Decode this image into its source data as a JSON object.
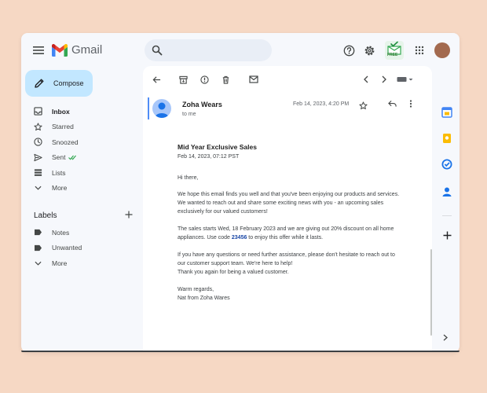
{
  "app": {
    "name": "Gmail",
    "colors": {
      "accent": "#c2e7ff",
      "brand_red": "#ea4335",
      "brand_blue": "#4285f4",
      "brand_green": "#34a853",
      "brand_yellow": "#fbbc04",
      "code": "#1a47a6"
    }
  },
  "topbar": {
    "icons": [
      "menu-icon",
      "gmail-logo",
      "search-icon",
      "help-icon",
      "settings-icon",
      "addon-icon",
      "apps-grid-icon",
      "account-avatar"
    ],
    "addon_badge": "FREE"
  },
  "compose": {
    "label": "Compose",
    "icon": "pencil-icon"
  },
  "nav": {
    "items": [
      {
        "label": "Inbox",
        "icon": "inbox-icon",
        "active": true
      },
      {
        "label": "Starred",
        "icon": "star-icon"
      },
      {
        "label": "Snoozed",
        "icon": "clock-icon"
      },
      {
        "label": "Sent",
        "icon": "send-icon"
      },
      {
        "label": "Lists",
        "icon": "list-icon"
      },
      {
        "label": "More",
        "icon": "chevron-down-icon"
      }
    ]
  },
  "labels": {
    "title": "Labels",
    "items": [
      {
        "label": "Notes",
        "icon": "label-icon"
      },
      {
        "label": "Unwanted",
        "icon": "label-icon"
      },
      {
        "label": "More",
        "icon": "chevron-down-icon"
      }
    ]
  },
  "toolbar": {
    "icons": [
      "back-arrow-icon",
      "archive-icon",
      "report-spam-icon",
      "delete-icon",
      "mark-unread-icon",
      "newer-icon",
      "older-icon",
      "keyboard-icon"
    ]
  },
  "email": {
    "sender": "Zoha Wears",
    "to": "to me",
    "date": "Feb 14, 2023, 4:20 PM",
    "subject": "Mid Year Exclusive Sales",
    "subject_date": "Feb 14, 2023, 07:12 PST",
    "greeting": "Hi there,",
    "para1": "We hope this email finds you well and that you've been enjoying our products and services. We wanted to reach out and share some exciting news with you - an upcoming sales exclusively for our valued customers!",
    "para2_before": "The sales starts Wed, 18 February 2023 and we are giving out 20% discount on all home appliances. Use code ",
    "code": "23456",
    "para2_after": " to enjoy this offer while it lasts.",
    "para3_line1": "If you have any questions or need further assistance, please don't hesitate to reach out to our customer support team. We're here to help!",
    "para3_line2": "Thank you again for being a valued customer.",
    "signoff": "Warm regards,",
    "signature": "Nat from Zoha Wares"
  },
  "side_panel": {
    "apps": [
      "calendar-icon",
      "keep-icon",
      "tasks-icon",
      "contacts-icon",
      "add-icon"
    ]
  }
}
